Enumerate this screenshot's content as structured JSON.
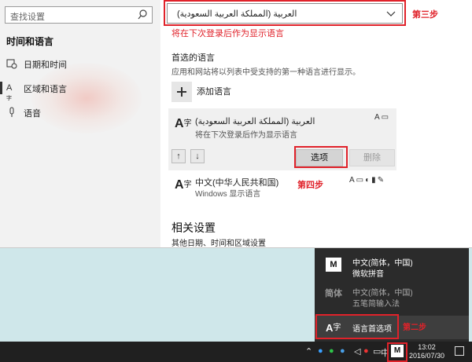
{
  "sidebar": {
    "search_placeholder": "查找设置",
    "section_title": "时间和语言",
    "items": [
      {
        "label": "日期和时间",
        "icon": "calendar-clock-icon"
      },
      {
        "label": "区域和语言",
        "icon": "language-icon"
      },
      {
        "label": "语音",
        "icon": "microphone-icon"
      }
    ]
  },
  "main": {
    "display_language_value": "العربية (المملكة العربية السعودية)",
    "step3_label": "第三步",
    "display_language_note": "将在下次登录后作为显示语言",
    "preferred_title": "首选的语言",
    "preferred_desc": "应用和网站将以列表中受支持的第一种语言进行显示。",
    "add_language_label": "添加语言",
    "languages": [
      {
        "name": "العربية (المملكة العربية السعودية)",
        "sub": "将在下次登录后作为显示语言"
      },
      {
        "name": "中文(中华人民共和国)",
        "sub": "Windows 显示语言"
      }
    ],
    "options_button": "选项",
    "remove_button": "删除",
    "step4_label": "第四步",
    "related_title": "相关设置",
    "related_link": "其他日期、时间和区域设置"
  },
  "ime_popup": {
    "items": [
      {
        "icon_text": "M",
        "line1": "中文(简体，中国)",
        "line2": "微软拼音"
      },
      {
        "icon_text": "简体",
        "line1": "中文(简体，中国)",
        "line2": "五笔简输入法"
      }
    ],
    "pref_label": "语言首选项",
    "step_label": "第二步"
  },
  "taskbar": {
    "ime_indicator": "中",
    "ime_m": "M",
    "time": "13:02",
    "date": "2016/07/30"
  },
  "colors": {
    "annotation_red": "#e0222a",
    "popup_bg": "#2b2b2b"
  }
}
